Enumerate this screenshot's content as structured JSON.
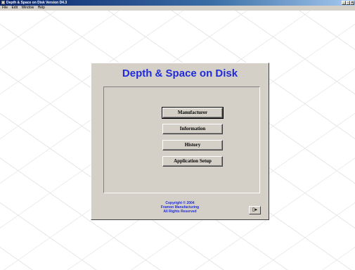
{
  "window": {
    "title": "Depth & Space on Disk  Version D4.3",
    "controls": {
      "minimize": "_",
      "restore": "▫",
      "close": "×"
    }
  },
  "menubar": {
    "items": [
      "File",
      "Edit",
      "Window",
      "Help"
    ]
  },
  "dialog": {
    "title": "Depth & Space on Disk",
    "buttons": {
      "manufacturer": "Manufacturer",
      "information": "Information",
      "history": "History",
      "application_setup": "Application Setup"
    },
    "copyright": {
      "line1": "Copyright © 2004",
      "line2": "Framon Manufacturing",
      "line3": "All Rights Reserved"
    },
    "exit_icon": "exit-door-icon",
    "exit_glyph": "▯▸"
  },
  "colors": {
    "title_text": "#1f2bd8",
    "dialog_bg": "#d4d0c8",
    "titlebar_start": "#0a246a"
  }
}
